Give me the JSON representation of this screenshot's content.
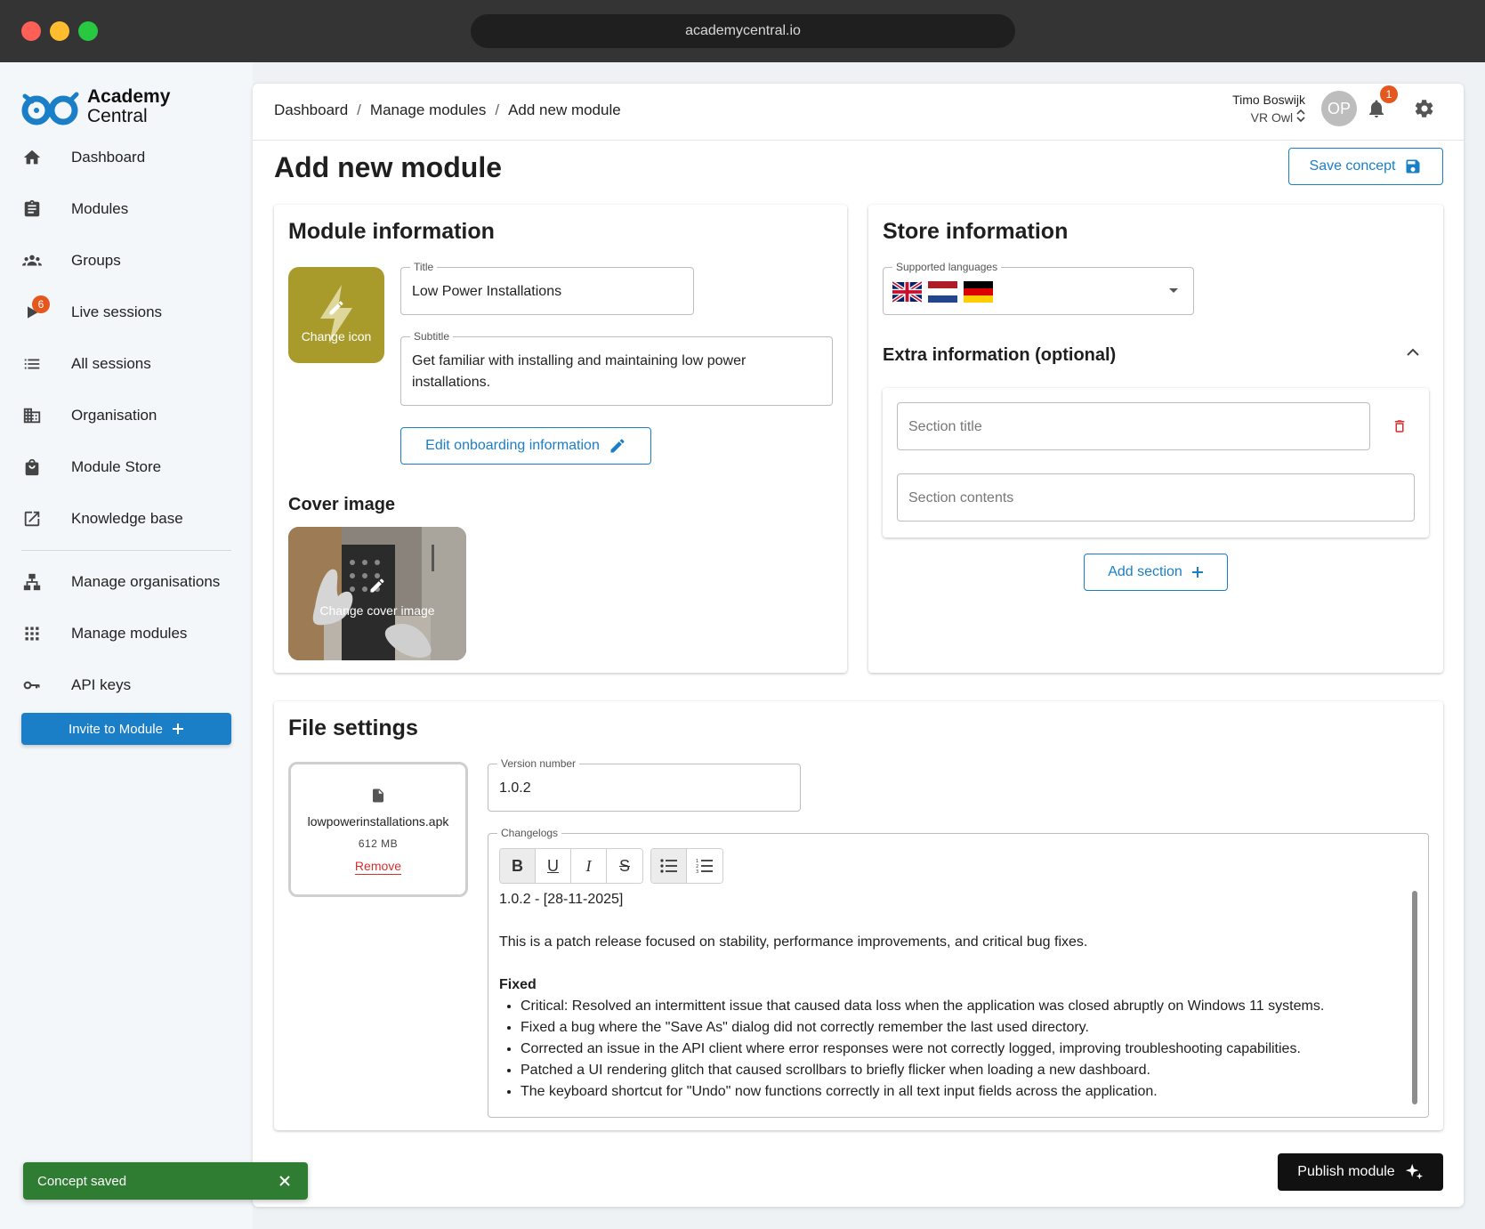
{
  "window": {
    "url": "academycentral.io"
  },
  "brand": {
    "line1": "Academy",
    "line2": "Central"
  },
  "sidebar": {
    "items": [
      {
        "label": "Dashboard",
        "icon": "home-icon"
      },
      {
        "label": "Modules",
        "icon": "clipboard-icon"
      },
      {
        "label": "Groups",
        "icon": "groups-icon"
      },
      {
        "label": "Live sessions",
        "icon": "play-icon",
        "badge": "6"
      },
      {
        "label": "All sessions",
        "icon": "list-icon"
      },
      {
        "label": "Organisation",
        "icon": "building-icon"
      },
      {
        "label": "Module Store",
        "icon": "shopping-bag-icon"
      },
      {
        "label": "Knowledge base",
        "icon": "external-link-icon"
      },
      {
        "label": "Manage organisations",
        "icon": "hierarchy-icon"
      },
      {
        "label": "Manage modules",
        "icon": "grid-icon"
      },
      {
        "label": "API keys",
        "icon": "key-icon"
      }
    ],
    "invite_label": "Invite to Module"
  },
  "topbar": {
    "breadcrumb": [
      "Dashboard",
      "Manage modules",
      "Add new module"
    ],
    "user_name": "Timo Boswijk",
    "user_org": "VR Owl",
    "avatar_initials": "OP",
    "notification_count": "1"
  },
  "page": {
    "title": "Add new module",
    "save_concept_label": "Save concept",
    "publish_label": "Publish module"
  },
  "module_info": {
    "heading": "Module information",
    "change_icon_label": "Change icon",
    "title_legend": "Title",
    "title_value": "Low Power Installations",
    "subtitle_legend": "Subtitle",
    "subtitle_value": "Get familiar with installing and maintaining low power installations.",
    "edit_onboarding_label": "Edit onboarding information",
    "cover_heading": "Cover image",
    "change_cover_label": "Change cover image"
  },
  "store_info": {
    "heading": "Store information",
    "languages_legend": "Supported languages",
    "languages": [
      "uk-flag",
      "netherlands-flag",
      "germany-flag"
    ],
    "extra_heading": "Extra information (optional)",
    "section_title_placeholder": "Section title",
    "section_contents_placeholder": "Section contents",
    "add_section_label": "Add section"
  },
  "file_settings": {
    "heading": "File settings",
    "file_name": "lowpowerinstallations.apk",
    "file_size": "612 MB",
    "remove_label": "Remove",
    "version_legend": "Version number",
    "version_value": "1.0.2",
    "changelog_legend": "Changelogs",
    "toolbar": [
      "B",
      "U",
      "I",
      "S"
    ],
    "changelog": {
      "heading_line": "1.0.2 - [28-11-2025]",
      "intro": "This is a patch release focused on stability, performance improvements, and critical bug fixes.",
      "fixed_heading": "Fixed",
      "items": [
        "Critical: Resolved an intermittent issue that caused data loss when the application was closed abruptly on Windows 11 systems.",
        "Fixed a bug where the \"Save As\" dialog did not correctly remember the last used directory.",
        "Corrected an issue in the API client where error responses were not correctly logged, improving troubleshooting capabilities.",
        "Patched a UI rendering glitch that caused scrollbars to briefly flicker when loading a new dashboard.",
        "The keyboard shortcut for \"Undo\" now functions correctly in all text input fields across the application."
      ]
    }
  },
  "toast": {
    "message": "Concept saved"
  },
  "colors": {
    "primary": "#1a7fc6",
    "badge": "#e4571e",
    "success": "#2e7d32",
    "danger": "#d32f2f",
    "icon_tile": "#a99a2c"
  }
}
